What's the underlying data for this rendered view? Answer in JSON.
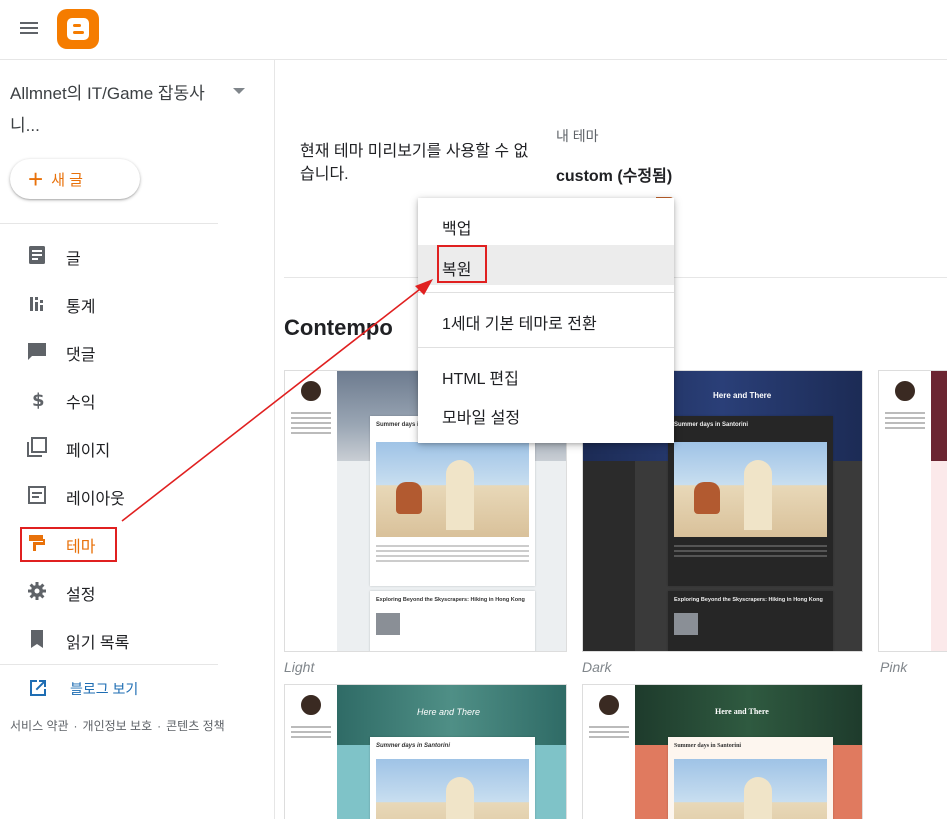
{
  "header": {
    "menu_icon": "hamburger-icon",
    "logo_icon": "blogger-logo-icon"
  },
  "sidebar": {
    "blog_title_line1": "Allmnet의 IT/Game 잡동사",
    "blog_title_line2": "니...",
    "new_post_label": "새 글",
    "items": [
      {
        "label": "글",
        "icon": "posts-icon"
      },
      {
        "label": "통계",
        "icon": "stats-icon"
      },
      {
        "label": "댓글",
        "icon": "comments-icon"
      },
      {
        "label": "수익",
        "icon": "dollar-icon"
      },
      {
        "label": "페이지",
        "icon": "pages-icon"
      },
      {
        "label": "레이아웃",
        "icon": "layout-icon"
      },
      {
        "label": "테마",
        "icon": "theme-icon",
        "active": true
      },
      {
        "label": "설정",
        "icon": "gear-icon"
      },
      {
        "label": "읽기 목록",
        "icon": "bookmark-icon"
      }
    ],
    "view_blog_label": "블로그 보기",
    "footer": {
      "terms": "서비스 약관",
      "privacy": "개인정보 보호",
      "content_policy": "콘텐츠 정책",
      "separator": "·"
    }
  },
  "main": {
    "preview_message": "현재 테마 미리보기를 사용할 수 없습니다.",
    "my_theme_label": "내 테마",
    "my_theme_name": "custom (수정됨)",
    "section_title": "Contempo",
    "themes": [
      {
        "label": "Light",
        "post_title": "Summer days in Santorini",
        "post2_title": "Exploring Beyond the Skyscrapers: Hiking in Hong Kong"
      },
      {
        "label": "Dark",
        "hero_title": "Here and There",
        "post_title": "Summer days in Santorini",
        "post2_title": "Exploring Beyond the Skyscrapers: Hiking in Hong Kong"
      },
      {
        "label": "Pink"
      },
      {
        "label": "",
        "hero_title": "Here and There",
        "post_title": "Summer days in Santorini"
      },
      {
        "label": "",
        "hero_title": "Here and There",
        "post_title": "Summer days in Santorini"
      }
    ]
  },
  "dropdown_menu": {
    "items": [
      {
        "label": "백업"
      },
      {
        "label": "복원",
        "hovered": true
      },
      {
        "label": "1세대 기본 테마로 전환"
      },
      {
        "label": "HTML 편집"
      },
      {
        "label": "모바일 설정"
      }
    ]
  },
  "colors": {
    "accent": "#e8710a",
    "logo": "#f57c00",
    "link": "#1e6db3",
    "annotation": "#e02020"
  }
}
